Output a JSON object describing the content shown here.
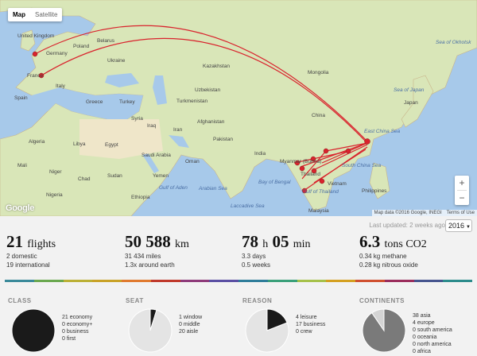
{
  "map": {
    "map_type_tabs": [
      "Map",
      "Satellite"
    ],
    "active_tab": "Map",
    "zoom_in": "+",
    "zoom_out": "−",
    "logo": "Google",
    "attribution": "Map data ©2016 Google, INEGI",
    "terms": "Terms of Use",
    "labels": {
      "united_kingdom": "United Kingdom",
      "germany": "Germany",
      "poland": "Poland",
      "belarus": "Belarus",
      "ukraine": "Ukraine",
      "france": "France",
      "italy": "Italy",
      "spain": "Spain",
      "greece": "Greece",
      "turkey": "Turkey",
      "kazakhstan": "Kazakhstan",
      "mongolia": "Mongolia",
      "uzbekistan": "Uzbekistan",
      "turkmenistan": "Turkmenistan",
      "afghanistan": "Afghanistan",
      "iran": "Iran",
      "iraq": "Iraq",
      "syria": "Syria",
      "pakistan": "Pakistan",
      "india": "India",
      "china": "China",
      "japan": "Japan",
      "algeria": "Algeria",
      "libya": "Libya",
      "egypt": "Egypt",
      "saudi_arabia": "Saudi Arabia",
      "mali": "Mali",
      "niger": "Niger",
      "chad": "Chad",
      "sudan": "Sudan",
      "nigeria": "Nigeria",
      "ethiopia": "Ethiopia",
      "yemen": "Yemen",
      "oman": "Oman",
      "myanmar": "Myanmar (Burma)",
      "thailand": "Thailand",
      "vietnam": "Vietnam",
      "philippines": "Philippines",
      "malaysia": "Malaysia",
      "sea_of_okhotsk": "Sea of Okhotsk",
      "sea_of_japan": "Sea of Japan",
      "east_china_sea": "East China Sea",
      "south_china_sea": "South China Sea",
      "arabian_sea": "Arabian Sea",
      "bay_of_bengal": "Bay of Bengal",
      "gulf_of_aden": "Gulf of Aden",
      "gulf_of_thailand": "Gulf of Thailand",
      "laccadive_sea": "Laccadive Sea"
    }
  },
  "header": {
    "last_updated": "Last updated: 2 weeks ago",
    "year": "2016"
  },
  "stats": {
    "flights": {
      "value": "21",
      "unit": "flights",
      "line1": "2 domestic",
      "line2": "19 international"
    },
    "distance": {
      "value": "50 588",
      "unit": "km",
      "line1": "31 434 miles",
      "line2": "1.3x around earth"
    },
    "time": {
      "value1": "78",
      "unit1": "h",
      "value2": "05",
      "unit2": "min",
      "line1": "3.3 days",
      "line2": "0.5 weeks"
    },
    "co2": {
      "value": "6.3",
      "unit": "tons CO2",
      "line1": "0.34 kg methane",
      "line2": "0.28 kg nitrous oxide"
    }
  },
  "colors": {
    "route": "#d9232d",
    "stripe": [
      "#3a8a9a",
      "#6aa84f",
      "#bbb035",
      "#c9a227",
      "#e07a2e",
      "#c0392b",
      "#8e3a7a",
      "#5a4fa3",
      "#2e7d9a",
      "#3aa07a",
      "#a6c14a",
      "#d4a020",
      "#d05030",
      "#9b2d5c",
      "#46558f",
      "#2c8c8c"
    ]
  },
  "sections": {
    "class": {
      "title": "CLASS",
      "items": [
        "21 economy",
        "0 economy+",
        "0 business",
        "0 first"
      ]
    },
    "seat": {
      "title": "SEAT",
      "items": [
        "1 window",
        "0 middle",
        "20 aisle"
      ]
    },
    "reason": {
      "title": "REASON",
      "items": [
        "4 leisure",
        "17 business",
        "0 crew"
      ]
    },
    "continents": {
      "title": "CONTINENTS",
      "items": [
        "38 asia",
        "4 europe",
        "0 south america",
        "0 oceania",
        "0 north america",
        "0 africa"
      ]
    }
  },
  "chart_data": [
    {
      "type": "pie",
      "categories": [
        "economy",
        "economy+",
        "business",
        "first"
      ],
      "values": [
        21,
        0,
        0,
        0
      ]
    },
    {
      "type": "pie",
      "categories": [
        "window",
        "middle",
        "aisle"
      ],
      "values": [
        1,
        0,
        20
      ]
    },
    {
      "type": "pie",
      "categories": [
        "leisure",
        "business",
        "crew"
      ],
      "values": [
        4,
        17,
        0
      ]
    },
    {
      "type": "pie",
      "categories": [
        "asia",
        "europe",
        "south america",
        "oceania",
        "north america",
        "africa"
      ],
      "values": [
        38,
        4,
        0,
        0,
        0,
        0
      ]
    }
  ]
}
